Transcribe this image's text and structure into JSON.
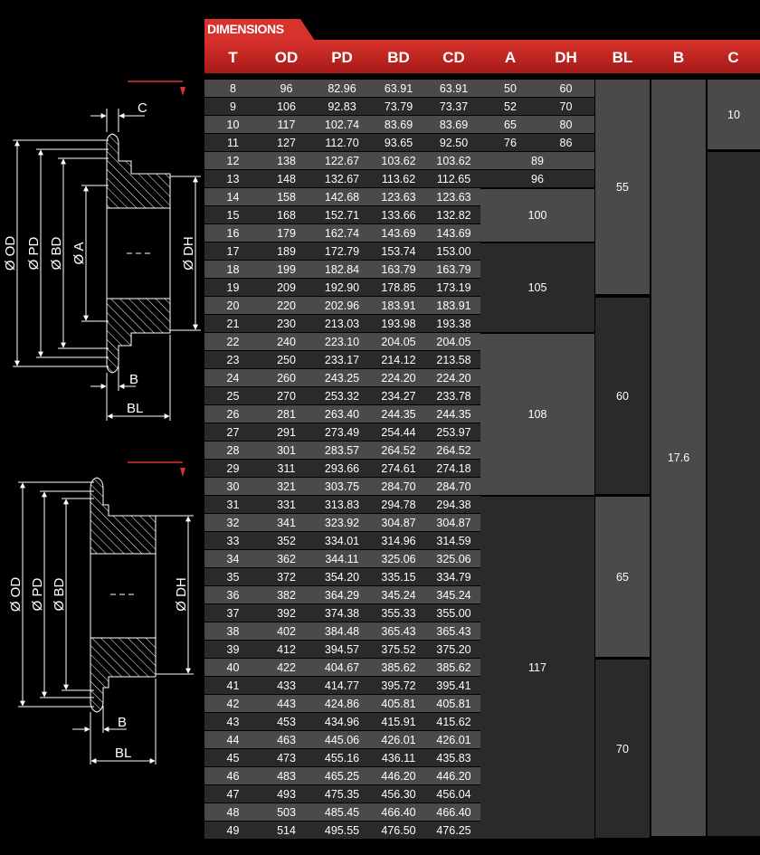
{
  "section_title": "DIMENSIONS",
  "columns": [
    "T",
    "OD",
    "PD",
    "BD",
    "CD",
    "A",
    "DH",
    "BL",
    "B",
    "C"
  ],
  "rows": [
    [
      "8",
      "96",
      "82.96",
      "63.91",
      "63.91"
    ],
    [
      "9",
      "106",
      "92.83",
      "73.79",
      "73.37"
    ],
    [
      "10",
      "117",
      "102.74",
      "83.69",
      "83.69"
    ],
    [
      "11",
      "127",
      "112.70",
      "93.65",
      "92.50"
    ],
    [
      "12",
      "138",
      "122.67",
      "103.62",
      "103.62"
    ],
    [
      "13",
      "148",
      "132.67",
      "113.62",
      "112.65"
    ],
    [
      "14",
      "158",
      "142.68",
      "123.63",
      "123.63"
    ],
    [
      "15",
      "168",
      "152.71",
      "133.66",
      "132.82"
    ],
    [
      "16",
      "179",
      "162.74",
      "143.69",
      "143.69"
    ],
    [
      "17",
      "189",
      "172.79",
      "153.74",
      "153.00"
    ],
    [
      "18",
      "199",
      "182.84",
      "163.79",
      "163.79"
    ],
    [
      "19",
      "209",
      "192.90",
      "178.85",
      "173.19"
    ],
    [
      "20",
      "220",
      "202.96",
      "183.91",
      "183.91"
    ],
    [
      "21",
      "230",
      "213.03",
      "193.98",
      "193.38"
    ],
    [
      "22",
      "240",
      "223.10",
      "204.05",
      "204.05"
    ],
    [
      "23",
      "250",
      "233.17",
      "214.12",
      "213.58"
    ],
    [
      "24",
      "260",
      "243.25",
      "224.20",
      "224.20"
    ],
    [
      "25",
      "270",
      "253.32",
      "234.27",
      "233.78"
    ],
    [
      "26",
      "281",
      "263.40",
      "244.35",
      "244.35"
    ],
    [
      "27",
      "291",
      "273.49",
      "254.44",
      "253.97"
    ],
    [
      "28",
      "301",
      "283.57",
      "264.52",
      "264.52"
    ],
    [
      "29",
      "311",
      "293.66",
      "274.61",
      "274.18"
    ],
    [
      "30",
      "321",
      "303.75",
      "284.70",
      "284.70"
    ],
    [
      "31",
      "331",
      "313.83",
      "294.78",
      "294.38"
    ],
    [
      "32",
      "341",
      "323.92",
      "304.87",
      "304.87"
    ],
    [
      "33",
      "352",
      "334.01",
      "314.96",
      "314.59"
    ],
    [
      "34",
      "362",
      "344.11",
      "325.06",
      "325.06"
    ],
    [
      "35",
      "372",
      "354.20",
      "335.15",
      "334.79"
    ],
    [
      "36",
      "382",
      "364.29",
      "345.24",
      "345.24"
    ],
    [
      "37",
      "392",
      "374.38",
      "355.33",
      "355.00"
    ],
    [
      "38",
      "402",
      "384.48",
      "365.43",
      "365.43"
    ],
    [
      "39",
      "412",
      "394.57",
      "375.52",
      "375.20"
    ],
    [
      "40",
      "422",
      "404.67",
      "385.62",
      "385.62"
    ],
    [
      "41",
      "433",
      "414.77",
      "395.72",
      "395.41"
    ],
    [
      "42",
      "443",
      "424.86",
      "405.81",
      "405.81"
    ],
    [
      "43",
      "453",
      "434.96",
      "415.91",
      "415.62"
    ],
    [
      "44",
      "463",
      "445.06",
      "426.01",
      "426.01"
    ],
    [
      "45",
      "473",
      "455.16",
      "436.11",
      "435.83"
    ],
    [
      "46",
      "483",
      "465.25",
      "446.20",
      "446.20"
    ],
    [
      "47",
      "493",
      "475.35",
      "456.30",
      "456.04"
    ],
    [
      "48",
      "503",
      "485.45",
      "466.40",
      "466.40"
    ],
    [
      "49",
      "514",
      "495.55",
      "476.50",
      "476.25"
    ]
  ],
  "a_dh_values": [
    [
      "50",
      "60"
    ],
    [
      "52",
      "70"
    ],
    [
      "65",
      "80"
    ],
    [
      "76",
      "86"
    ]
  ],
  "dh_merged": [
    {
      "from": 4,
      "to": 4,
      "value": "89"
    },
    {
      "from": 5,
      "to": 5,
      "value": "96"
    },
    {
      "from": 6,
      "to": 8,
      "value": "100"
    },
    {
      "from": 9,
      "to": 13,
      "value": "105"
    },
    {
      "from": 14,
      "to": 22,
      "value": "108"
    },
    {
      "from": 23,
      "to": 41,
      "value": "117"
    }
  ],
  "bl_groups": [
    {
      "from": 0,
      "to": 11,
      "value": "55"
    },
    {
      "from": 12,
      "to": 22,
      "value": "60"
    },
    {
      "from": 23,
      "to": 31,
      "value": "65"
    },
    {
      "from": 32,
      "to": 41,
      "value": "70"
    }
  ],
  "b_value": "17.6",
  "c_value": "10",
  "diagram_labels": {
    "c": "C",
    "od": "Ø OD",
    "pd": "Ø PD",
    "bd": "Ø BD",
    "a": "Ø A",
    "dh": "Ø DH",
    "b": "B",
    "bl": "BL"
  },
  "colors": {
    "accent": "#d8322c",
    "row_light": "#4a4a4a",
    "row_dark": "#2a2a2a",
    "background": "#000000"
  }
}
